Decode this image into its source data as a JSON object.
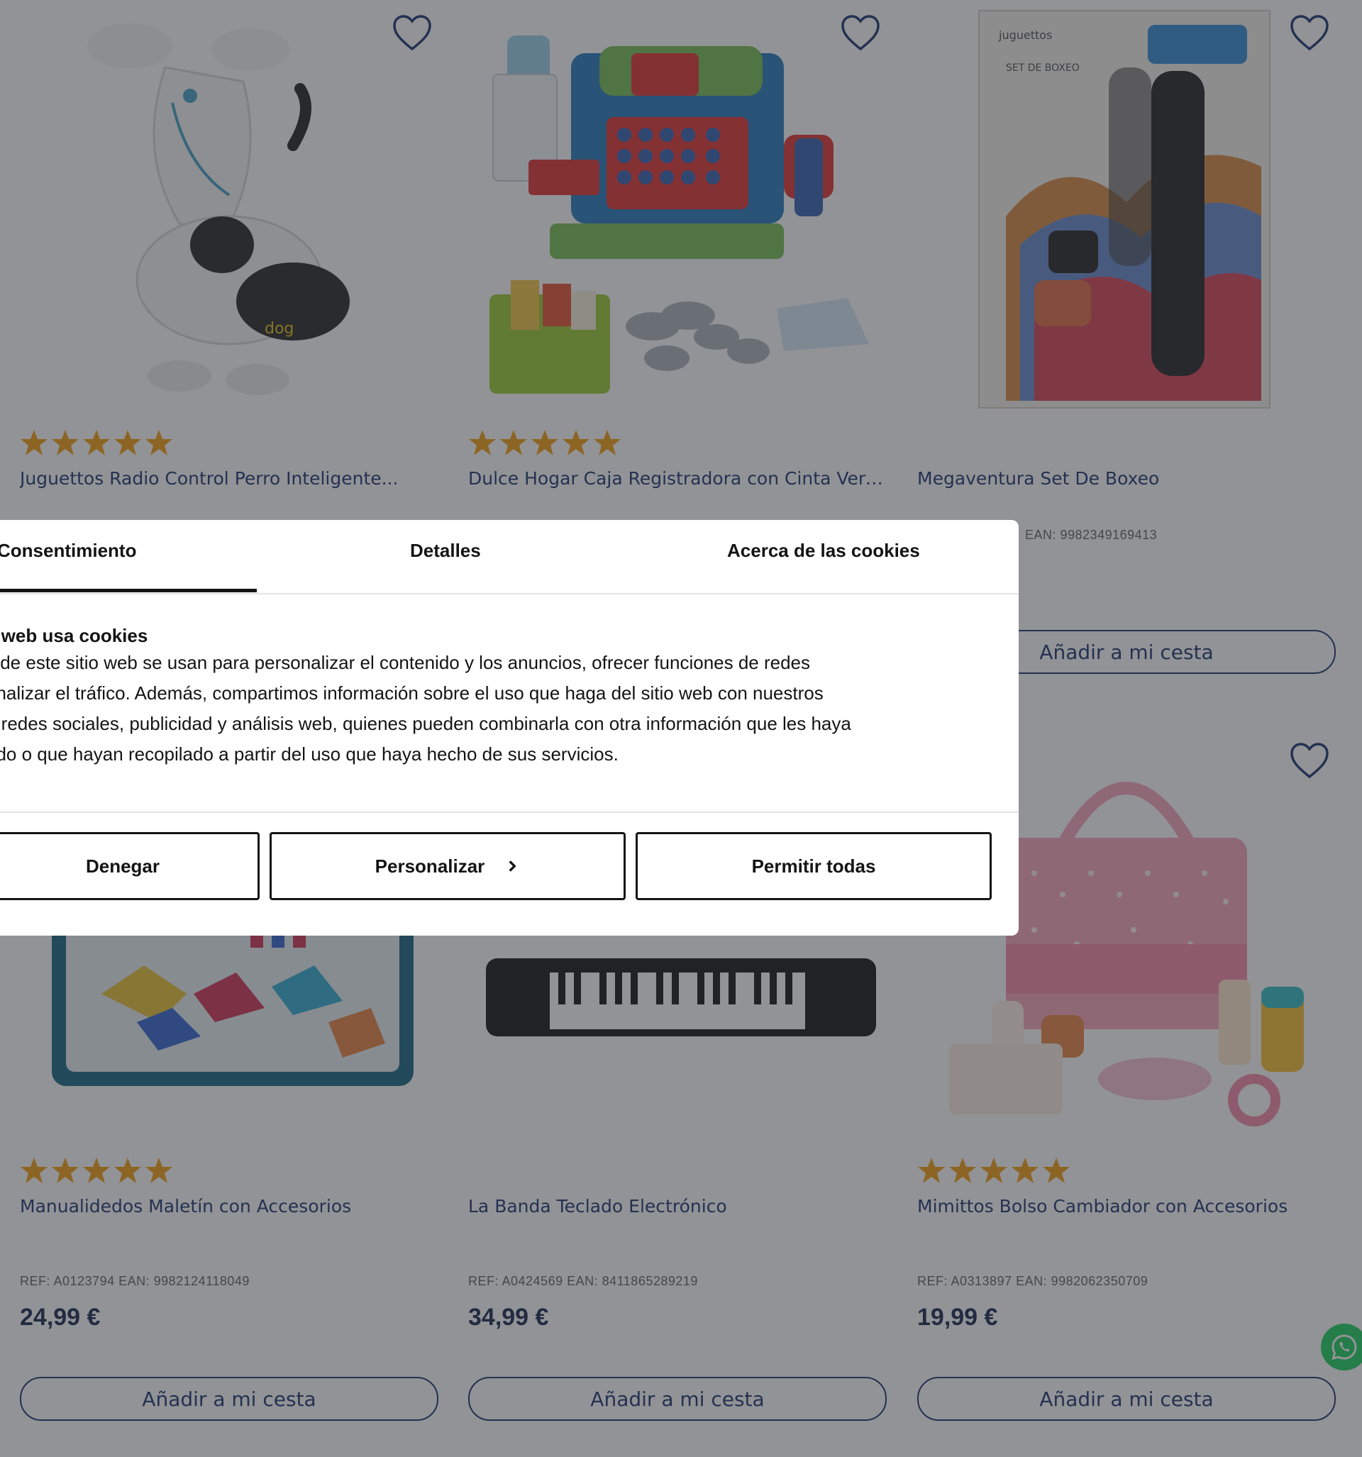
{
  "products": [
    {
      "name": "Juguettos Radio Control Perro Inteligente...",
      "ref": "",
      "price": "",
      "cart_label": "",
      "has_rating": true,
      "image": "robot-dog"
    },
    {
      "name": "Dulce Hogar Caja Registradora con Cinta Verde",
      "ref": "",
      "price": "",
      "cart_label": "",
      "has_rating": true,
      "image": "cash-register"
    },
    {
      "name": "Megaventura Set De Boxeo",
      "ref": "EAN: 9982349169413",
      "price": "",
      "cart_label": "Añadir a mi cesta",
      "has_rating": false,
      "image": "boxing-set"
    },
    {
      "name": "Manualidedos Maletín con Accesorios",
      "ref": "REF: A0123794 EAN: 9982124118049",
      "price": "24,99 €",
      "cart_label": "Añadir a mi cesta",
      "has_rating": true,
      "image": "craft-case"
    },
    {
      "name": "La Banda Teclado Electrónico",
      "ref": "REF: A0424569 EAN: 8411865289219",
      "price": "34,99 €",
      "cart_label": "Añadir a mi cesta",
      "has_rating": false,
      "image": "keyboard"
    },
    {
      "name": "Mimittos Bolso Cambiador con Accesorios",
      "ref": "REF: A0313897 EAN: 9982062350709",
      "price": "19,99 €",
      "cart_label": "Añadir a mi cesta",
      "has_rating": true,
      "image": "diaper-bag"
    }
  ],
  "cookie_dialog": {
    "tabs": [
      "Consentimiento",
      "Detalles",
      "Acerca de las cookies"
    ],
    "active_tab": "Consentimiento",
    "title": "a web usa cookies",
    "body_lines": [
      "s de este sitio web se usan para personalizar el contenido y los anuncios, ofrecer funciones de redes",
      "analizar el tráfico. Además, compartimos información sobre el uso que haga del sitio web con nuestros",
      "e redes sociales, publicidad y análisis web, quienes pueden combinarla con otra información que les haya",
      "ado o que hayan recopilado a partir del uso que haya hecho de sus servicios."
    ],
    "buttons": {
      "deny": "Denegar",
      "customize": "Personalizar",
      "allow_all": "Permitir todas"
    }
  },
  "colors": {
    "brand_blue": "#233b74",
    "star": "#f3a21a",
    "overlay": "#26282e",
    "whatsapp": "#25d366"
  },
  "icons": [
    "heart-icon",
    "star-icon",
    "chevron-right-icon",
    "whatsapp-icon"
  ]
}
